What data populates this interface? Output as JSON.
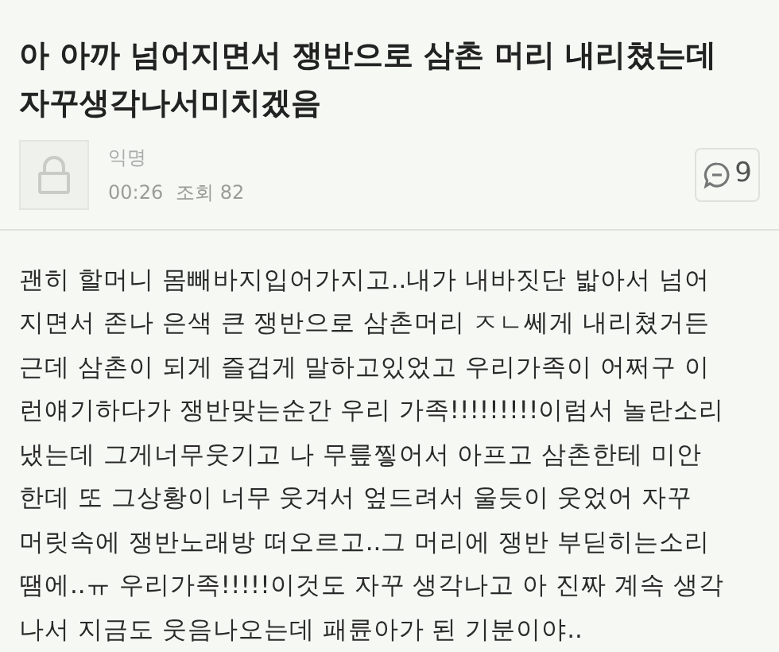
{
  "post": {
    "title": "아 아까 넘어지면서 쟁반으로 삼촌 머리 내리쳤는데\n자꾸생각나서미치겠음",
    "author": "익명",
    "time": "00:26",
    "views": "조회 82",
    "comment_count": "9",
    "body": "괜히 할머니 몸빼바지입어가지고..내가 내바짓단 밟아서 넘어\n지면서 존나 은색 큰 쟁반으로 삼촌머리 ㅈㄴ쎄게 내리쳤거든\n근데 삼촌이 되게 즐겁게 말하고있었고 우리가족이 어쩌구 이\n런얘기하다가 쟁반맞는순간 우리 가족!!!!!!!!!이럼서 놀란소리\n냈는데 그게너무웃기고 나 무릎찧어서 아프고 삼촌한테 미안\n한데 또 그상황이 너무 웃겨서 엎드려서 울듯이 웃었어 자꾸\n머릿속에 쟁반노래방 떠오르고..그 머리에 쟁반 부딛히는소리\n땜에..ㅠ 우리가족!!!!!이것도 자꾸 생각나고 아 진짜 계속 생각\n나서 지금도 웃음나오는데 패륜아가 된 기분이야.."
  }
}
